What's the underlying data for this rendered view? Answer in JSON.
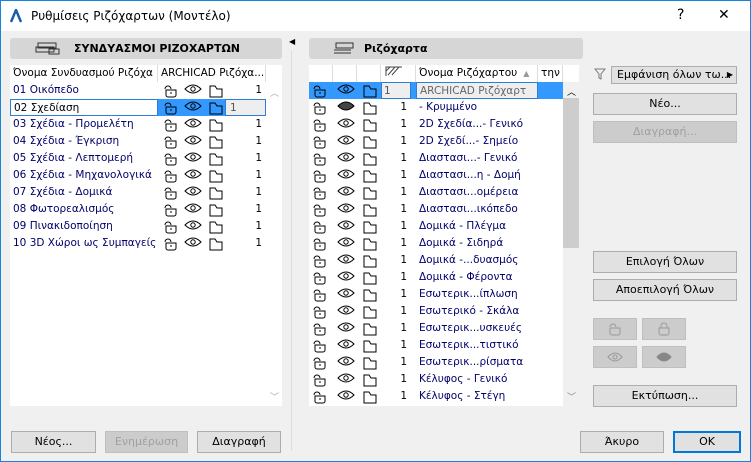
{
  "window": {
    "title": "Ρυθμίσεις Ριζόχαρτων (Μοντέλο)",
    "help": "?",
    "close": "✕"
  },
  "left": {
    "header": "ΣΥΝΔΥΑΣΜΟΙ ΡΙΖΟΧΑΡΤΩΝ",
    "columns": [
      "Όνομα Συνδυασμού Ριζόχα",
      "ARCHICAD Ριζόχα..."
    ],
    "rows": [
      {
        "name": "01 Οικόπεδο",
        "num": "1"
      },
      {
        "name": "02 Σχεδίαση",
        "num": "1"
      },
      {
        "name": "03 Σχέδια - Προμελέτη",
        "num": "1"
      },
      {
        "name": "04 Σχέδια - Έγκριση",
        "num": "1"
      },
      {
        "name": "05 Σχέδια - Λεπτομερή",
        "num": "1"
      },
      {
        "name": "06 Σχέδια - Μηχανολογικά",
        "num": "1"
      },
      {
        "name": "07 Σχέδια - Δομικά",
        "num": "1"
      },
      {
        "name": "08 Φωτορεαλισμός",
        "num": "1"
      },
      {
        "name": "09 Πινακιδοποίηση",
        "num": "1"
      },
      {
        "name": "10 3D Χώροι ως Συμπαγείς",
        "num": "1"
      }
    ],
    "selected_index": 1,
    "buttons": {
      "new": "Νέος...",
      "update": "Ενημέρωση",
      "delete": "Διαγραφή"
    }
  },
  "right": {
    "header": "Ριζόχαρτα",
    "columns": {
      "name": "Όνομα Ριζόχαρτου",
      "extra": "την"
    },
    "rows": [
      {
        "name": "ARCHICAD Ριζόχαρτ",
        "num": "1",
        "hidden": false
      },
      {
        "name": "- Κρυμμένο",
        "num": "1",
        "hidden": true
      },
      {
        "name": "2D Σχεδία...- Γενικό",
        "num": "1",
        "hidden": false
      },
      {
        "name": "2D Σχεδί...- Σημείο",
        "num": "1",
        "hidden": false
      },
      {
        "name": "Διαστασι...- Γενικό",
        "num": "1",
        "hidden": false
      },
      {
        "name": "Διαστασι...η - Δομή",
        "num": "1",
        "hidden": false
      },
      {
        "name": "Διαστασι...ομέρεια",
        "num": "1",
        "hidden": false
      },
      {
        "name": "Διαστασι...ικόπεδο",
        "num": "1",
        "hidden": false
      },
      {
        "name": "Δομικά - Πλέγμα",
        "num": "1",
        "hidden": false
      },
      {
        "name": "Δομικά - Σιδηρά",
        "num": "1",
        "hidden": false
      },
      {
        "name": "Δομικά -...δυασμός",
        "num": "1",
        "hidden": false
      },
      {
        "name": "Δομικά - Φέροντα",
        "num": "1",
        "hidden": false
      },
      {
        "name": "Εσωτερικ...ίπλωση",
        "num": "1",
        "hidden": false
      },
      {
        "name": "Εσωτερικό - Σκάλα",
        "num": "1",
        "hidden": false
      },
      {
        "name": "Εσωτερικ...υσκευές",
        "num": "1",
        "hidden": false
      },
      {
        "name": "Εσωτερικ...τιστικό",
        "num": "1",
        "hidden": false
      },
      {
        "name": "Εσωτερικ...ρίσματα",
        "num": "1",
        "hidden": false
      },
      {
        "name": "Κέλυφος - Γενικό",
        "num": "1",
        "hidden": false
      },
      {
        "name": "Κέλυφος - Στέγη",
        "num": "1",
        "hidden": false
      }
    ],
    "filter": "Εμφάνιση όλων τω...",
    "buttons": {
      "new": "Νέο...",
      "delete": "Διαγραφή...",
      "select_all": "Επιλογή Όλων",
      "deselect_all": "Αποεπιλογή Όλων",
      "print": "Εκτύπωση...",
      "cancel": "Άκυρο",
      "ok": "OK"
    }
  }
}
